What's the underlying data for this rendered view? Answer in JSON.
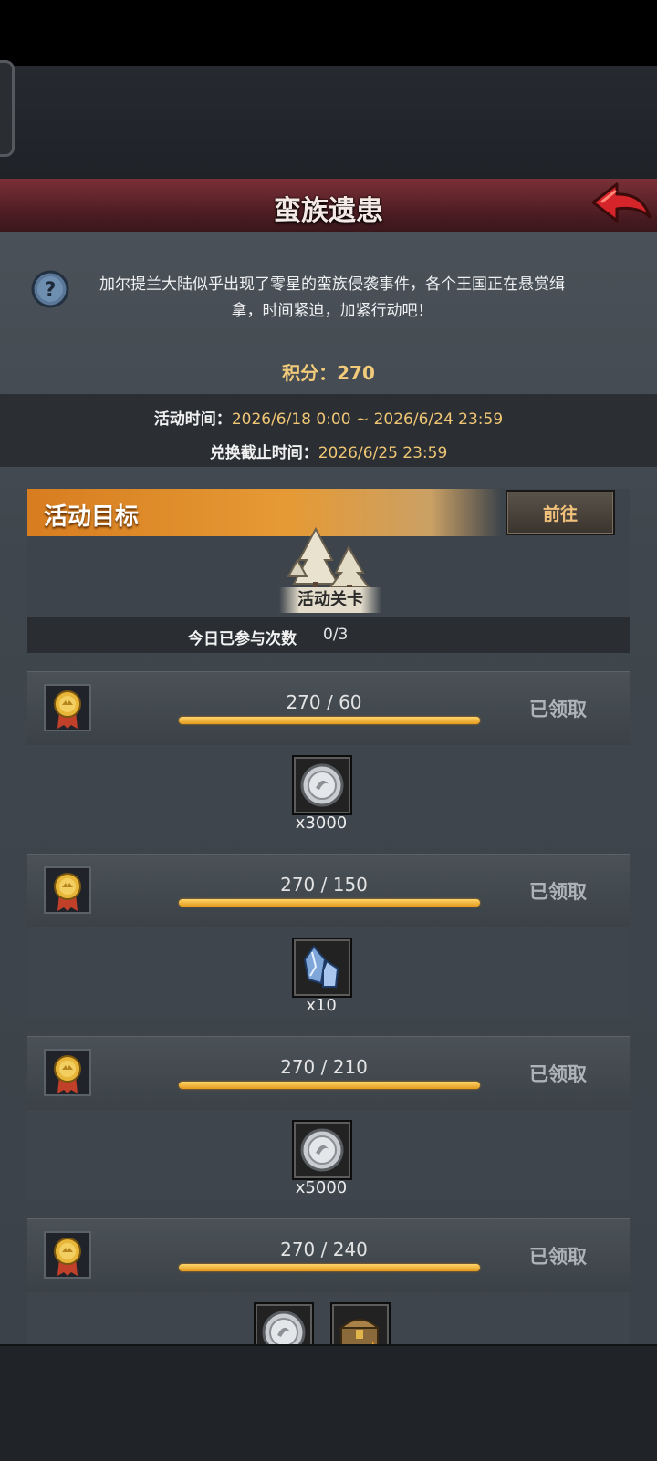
{
  "header": {
    "title": "蛮族遗患"
  },
  "description": {
    "line1": "加尔提兰大陆似乎出现了零星的蛮族侵袭事件，各个王国正在悬赏缉",
    "line2": "拿，时间紧迫，加紧行动吧！"
  },
  "score": {
    "label": "积分：",
    "value": "270"
  },
  "times": {
    "activity_label": "活动时间：",
    "activity_value": "2026/6/18 0:00 ~ 2026/6/24 23:59",
    "exchange_label": "兑换截止时间：",
    "exchange_value": "2026/6/25 23:59"
  },
  "goal": {
    "title": "活动目标",
    "go_button": "前往",
    "stage_label": "活动关卡",
    "today_label": "今日已参与次数",
    "today_value": "0/3"
  },
  "tasks": [
    {
      "progress": "270 / 60",
      "fill_fraction": 1.0,
      "status": "已领取",
      "rewards": [
        {
          "icon": "silver-coin-icon",
          "qty": "x3000"
        }
      ]
    },
    {
      "progress": "270 / 150",
      "fill_fraction": 1.0,
      "status": "已领取",
      "rewards": [
        {
          "icon": "blue-crystal-icon",
          "qty": "x10"
        }
      ]
    },
    {
      "progress": "270 / 210",
      "fill_fraction": 1.0,
      "status": "已领取",
      "rewards": [
        {
          "icon": "silver-coin-icon",
          "qty": "x5000"
        }
      ]
    },
    {
      "progress": "270 / 240",
      "fill_fraction": 1.0,
      "status": "已领取",
      "rewards": [
        {
          "icon": "silver-coin-icon"
        },
        {
          "icon": "treasure-chest-icon"
        }
      ]
    }
  ],
  "colors": {
    "banner": "#5a2228",
    "accent_orange": "#e38a27",
    "gold_text": "#f1ca7a",
    "claimed_text": "#aeb3b8"
  }
}
